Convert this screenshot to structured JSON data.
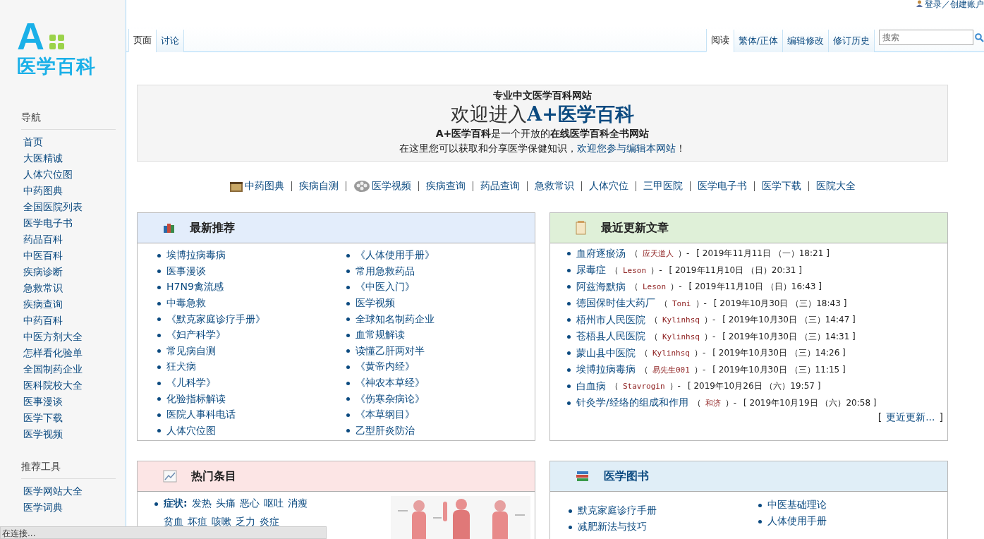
{
  "user_links": "登录／创建账户",
  "logo": {
    "mark": "A",
    "name": "医学百科"
  },
  "sidebar": {
    "sections": [
      {
        "title": "导航",
        "items": [
          "首页",
          "大医精诚",
          "人体穴位图",
          "中药图典",
          "全国医院列表",
          "医学电子书",
          "药品百科",
          "中医百科",
          "疾病诊断",
          "急救常识",
          "疾病查询",
          "中药百科",
          "中医方剂大全",
          "怎样看化验单",
          "全国制药企业",
          "医科院校大全",
          "医事漫谈",
          "医学下载",
          "医学视频"
        ]
      },
      {
        "title": "推荐工具",
        "items": [
          "医学网站大全",
          "医学词典"
        ]
      }
    ]
  },
  "left_tabs": [
    {
      "label": "页面",
      "selected": true
    },
    {
      "label": "讨论",
      "selected": false
    }
  ],
  "right_tabs": [
    {
      "label": "阅读",
      "selected": true
    },
    {
      "label": "繁体/正体",
      "selected": false
    },
    {
      "label": "编辑修改",
      "selected": false
    },
    {
      "label": "修订历史",
      "selected": false
    }
  ],
  "search": {
    "placeholder": "搜索"
  },
  "welcome": {
    "subtitle": "专业中文医学百科网站",
    "title_prefix": "欢迎进入",
    "title_brand": "A+医学百科",
    "tagline": "**A+医学百科**是一个开放的**在线医学百科全书网站**",
    "line": "在这里您可以获取和分享医学保健知识，",
    "link": "欢迎您参与编辑本网站",
    "end": "！"
  },
  "quick_links": [
    {
      "label": "中药图典",
      "kind": "chest"
    },
    {
      "label": "疾病自测",
      "kind": "plain"
    },
    {
      "label": "医学视频",
      "kind": "reel"
    },
    {
      "label": "疾病查询",
      "kind": "plain"
    },
    {
      "label": "药品查询",
      "kind": "plain"
    },
    {
      "label": "急救常识",
      "kind": "plain"
    },
    {
      "label": "人体穴位",
      "kind": "plain"
    },
    {
      "label": "三甲医院",
      "kind": "plain"
    },
    {
      "label": "医学电子书",
      "kind": "plain"
    },
    {
      "label": "医学下载",
      "kind": "plain"
    },
    {
      "label": "医院大全",
      "kind": "plain"
    }
  ],
  "latest": {
    "title": "最新推荐",
    "columns": [
      [
        "埃博拉病毒病",
        "医事漫谈",
        "H7N9禽流感",
        "中毒急救",
        "《默克家庭诊疗手册》",
        "《妇产科学》",
        "常见病自测",
        "狂犬病",
        "《儿科学》",
        "化验指标解读",
        "医院人事科电话",
        "人体穴位图"
      ],
      [
        "《人体使用手册》",
        "常用急救药品",
        "《中医入门》",
        "医学视频",
        "全球知名制药企业",
        "血常规解读",
        "读懂乙肝两对半",
        "《黄帝内经》",
        "《神农本草经》",
        "《伤寒杂病论》",
        "《本草纲目》",
        "乙型肝炎防治"
      ]
    ]
  },
  "recent": {
    "title": "最近更新文章",
    "items": [
      {
        "title": "血府逐瘀汤",
        "open": "（",
        "author": "应天道人",
        "close": "）-",
        "date": "[ 2019年11月11日 （一）18:21 ]"
      },
      {
        "title": "尿毒症",
        "open": "（",
        "author": "Leson",
        "close": "）-",
        "date": "[ 2019年11月10日 （日）20:31 ]"
      },
      {
        "title": "阿兹海默病",
        "open": "（",
        "author": "Leson",
        "close": "）-",
        "date": "[ 2019年11月10日 （日）16:43 ]"
      },
      {
        "title": "德国保时佳大药厂",
        "open": "（",
        "author": "Toni",
        "close": "）-",
        "date": "[ 2019年10月30日 （三）18:43 ]"
      },
      {
        "title": "梧州市人民医院",
        "open": "（",
        "author": "Kylinhsq",
        "close": "）-",
        "date": "[ 2019年10月30日 （三）14:47 ]"
      },
      {
        "title": "苍梧县人民医院",
        "open": "（",
        "author": "Kylinhsq",
        "close": "）-",
        "date": "[ 2019年10月30日 （三）14:31 ]"
      },
      {
        "title": "蒙山县中医院",
        "open": "（",
        "author": "Kylinhsq",
        "close": "）-",
        "date": "[ 2019年10月30日 （三）14:26 ]"
      },
      {
        "title": "埃博拉病毒病",
        "open": "（",
        "author": "易先生001",
        "close": "）-",
        "date": "[ 2019年10月30日 （三）11:15 ]"
      },
      {
        "title": "白血病",
        "open": "（",
        "author": "Stavrogin",
        "close": "）-",
        "date": "[ 2019年10月26日 （六）19:57 ]"
      },
      {
        "title": "针灸学/经络的组成和作用",
        "open": "（",
        "author": "和济",
        "close": "）-",
        "date": "[ 2019年10月19日 （六）20:58 ]"
      }
    ],
    "more_open": "[",
    "more": "更近更新...",
    "more_close": "]"
  },
  "hot": {
    "title": "热门条目",
    "label": "症状:",
    "lines": [
      [
        "发热",
        "头痛",
        "恶心",
        "呕吐",
        "消瘦"
      ],
      [
        "贫血",
        "坏疽",
        "咳嗽",
        "乏力",
        "炎症"
      ]
    ]
  },
  "books": {
    "title": "医学图书",
    "columns": [
      [
        "默克家庭诊疗手册",
        "减肥新法与技巧"
      ],
      [
        "中医基础理论",
        "人体使用手册"
      ]
    ]
  },
  "status": "在连接..."
}
